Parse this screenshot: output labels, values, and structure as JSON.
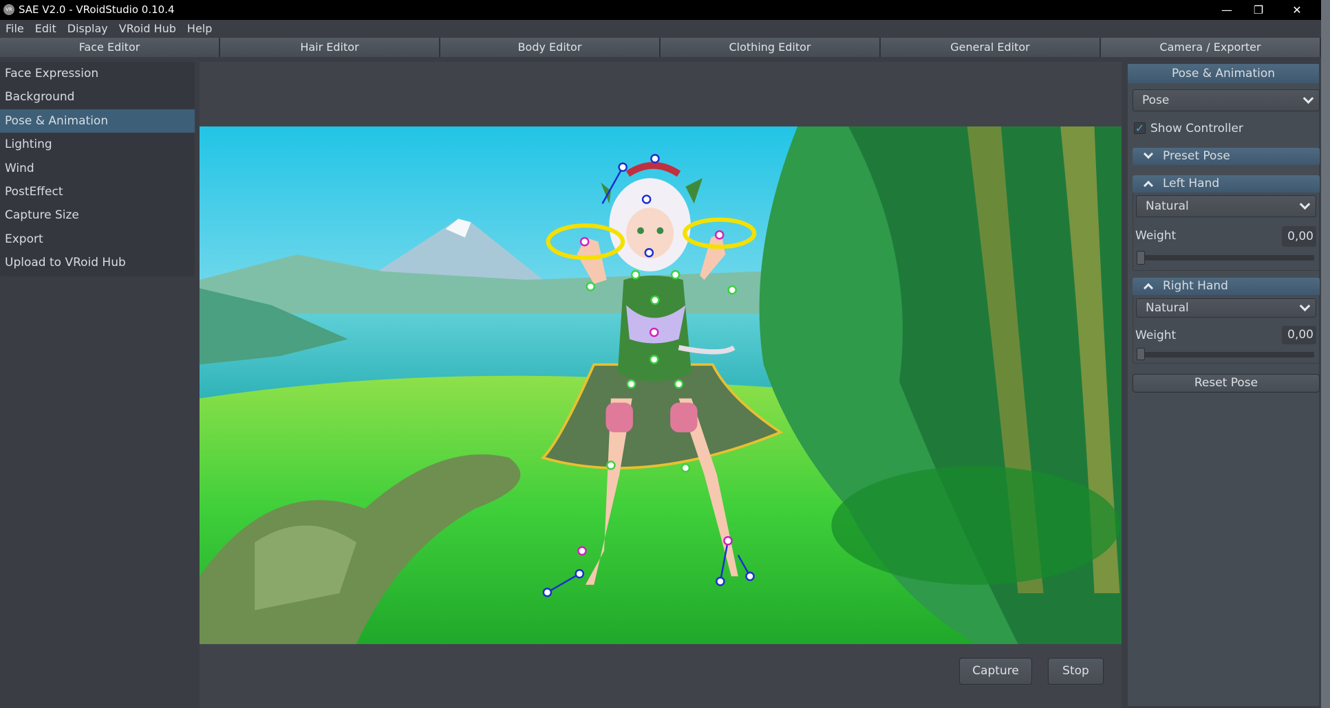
{
  "window": {
    "title": "SAE V2.0 - VRoidStudio 0.10.4",
    "logo_text": "VR",
    "minimize_icon": "minimize-icon",
    "maximize_icon": "restore-icon",
    "close_icon": "close-icon"
  },
  "menu": [
    "File",
    "Edit",
    "Display",
    "VRoid Hub",
    "Help"
  ],
  "tabs": [
    {
      "label": "Face Editor"
    },
    {
      "label": "Hair Editor"
    },
    {
      "label": "Body Editor"
    },
    {
      "label": "Clothing Editor"
    },
    {
      "label": "General Editor"
    },
    {
      "label": "Camera / Exporter",
      "active": true
    }
  ],
  "sidebar": {
    "items": [
      "Face Expression",
      "Background",
      "Pose & Animation",
      "Lighting",
      "Wind",
      "PostEffect",
      "Capture Size",
      "Export",
      "Upload to VRoid Hub"
    ],
    "active": "Pose & Animation"
  },
  "viewport": {
    "capture_label": "Capture",
    "stop_label": "Stop"
  },
  "panel": {
    "title": "Pose & Animation",
    "mode_select": "Pose",
    "show_controller_label": "Show Controller",
    "show_controller_checked": true,
    "preset_pose_label": "Preset Pose",
    "left_hand": {
      "label": "Left Hand",
      "select": "Natural",
      "weight_label": "Weight",
      "weight": "0,00",
      "weight_fraction": 0
    },
    "right_hand": {
      "label": "Right Hand",
      "select": "Natural",
      "weight_label": "Weight",
      "weight": "0,00",
      "weight_fraction": 0
    },
    "reset_label": "Reset Pose"
  },
  "colors": {
    "accent": "#3d5f78",
    "checkbox": "#4aa3df",
    "controller_blue": "#1a2fd0",
    "controller_magenta": "#d020c0",
    "controller_green": "#3cd040",
    "ring": "#f5e000"
  }
}
